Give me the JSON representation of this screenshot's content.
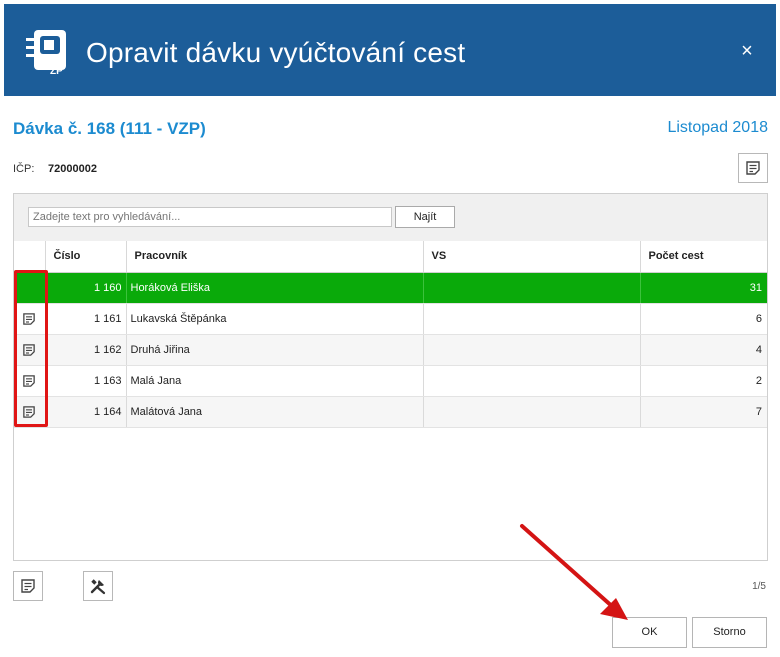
{
  "header": {
    "logo_text": "ZP",
    "title": "Opravit dávku vyúčtování cest",
    "close_glyph": "×",
    "bg_color": "#1c5d99"
  },
  "batch": {
    "title": "Dávka č. 168 (111 - VZP)",
    "period": "Listopad 2018",
    "accent_color": "#1c8bd0"
  },
  "icp": {
    "label": "IČP:",
    "value": "72000002"
  },
  "search": {
    "placeholder": "Zadejte text pro vyhledávání...",
    "button_label": "Najít"
  },
  "table": {
    "columns": [
      "Číslo",
      "Pracovník",
      "VS",
      "Počet cest"
    ],
    "rows": [
      {
        "number": "1 160",
        "worker": "Horáková Eliška",
        "vs": "",
        "count": "31",
        "selected": true
      },
      {
        "number": "1 161",
        "worker": "Lukavská Štěpánka",
        "vs": "",
        "count": "6",
        "selected": false
      },
      {
        "number": "1 162",
        "worker": "Druhá Jiřina",
        "vs": "",
        "count": "4",
        "selected": false
      },
      {
        "number": "1 163",
        "worker": "Malá Jana",
        "vs": "",
        "count": "2",
        "selected": false
      },
      {
        "number": "1 164",
        "worker": "Malátová Jana",
        "vs": "",
        "count": "7",
        "selected": false
      }
    ],
    "selected_color": "#0aaa0a"
  },
  "icons": {
    "detail": "document-icon",
    "tools": "tools-icon"
  },
  "footer": {
    "page_info": "1/5",
    "ok_label": "OK",
    "cancel_label": "Storno"
  },
  "annotation_color": "#e01515"
}
